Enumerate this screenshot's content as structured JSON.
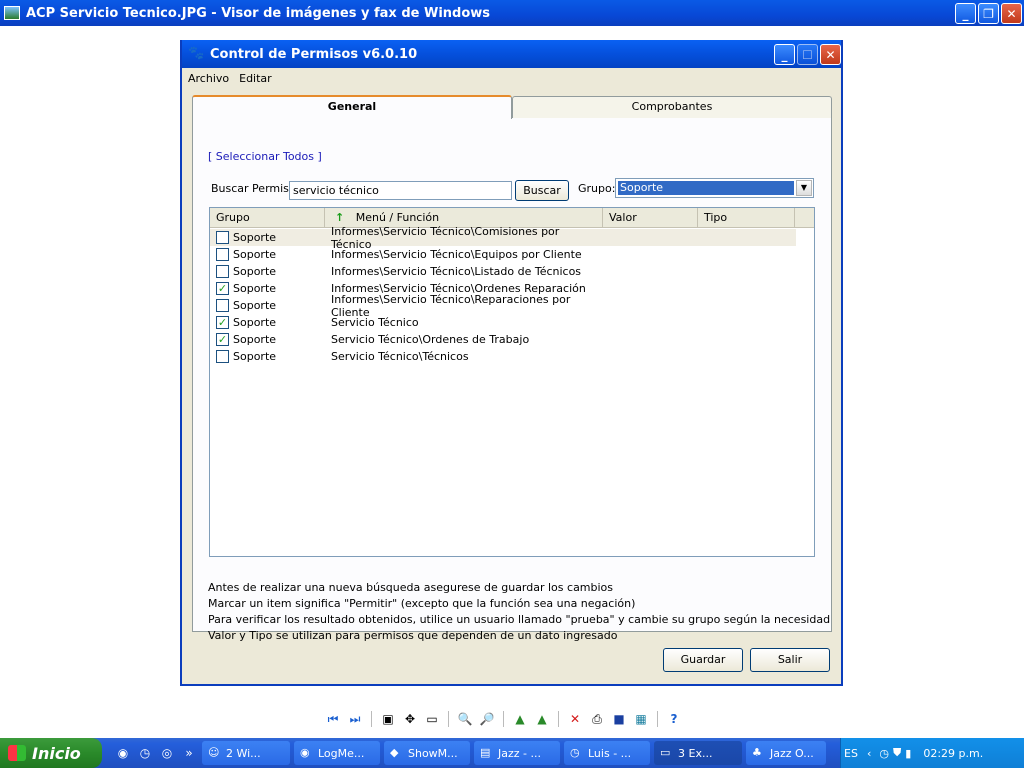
{
  "viewer": {
    "title": "ACP Servicio Tecnico.JPG - Visor de imágenes y fax de Windows"
  },
  "dialog": {
    "title": "Control de Permisos v6.0.10",
    "menu": [
      "Archivo",
      "Editar"
    ],
    "tabs": [
      {
        "label": "General",
        "active": true
      },
      {
        "label": "Comprobantes",
        "active": false
      }
    ],
    "select_all_link": "[ Seleccionar Todos ]",
    "search": {
      "label": "Buscar Permiso:",
      "value": "servicio técnico",
      "button": "Buscar"
    },
    "group": {
      "label": "Grupo:",
      "selected": "Soporte"
    },
    "grid": {
      "columns": [
        "Grupo",
        "Menú / Función",
        "Valor",
        "Tipo"
      ],
      "rows": [
        {
          "grupo": "Soporte",
          "menu": "Informes\\Servicio Técnico\\Comisiones por Técnico",
          "checked": false
        },
        {
          "grupo": "Soporte",
          "menu": "Informes\\Servicio Técnico\\Equipos por Cliente",
          "checked": false
        },
        {
          "grupo": "Soporte",
          "menu": "Informes\\Servicio Técnico\\Listado de Técnicos",
          "checked": false
        },
        {
          "grupo": "Soporte",
          "menu": "Informes\\Servicio Técnico\\Ordenes Reparación",
          "checked": true
        },
        {
          "grupo": "Soporte",
          "menu": "Informes\\Servicio Técnico\\Reparaciones por Cliente",
          "checked": false
        },
        {
          "grupo": "Soporte",
          "menu": "Servicio Técnico",
          "checked": true
        },
        {
          "grupo": "Soporte",
          "menu": "Servicio Técnico\\Ordenes de Trabajo",
          "checked": true
        },
        {
          "grupo": "Soporte",
          "menu": "Servicio Técnico\\Técnicos",
          "checked": false
        }
      ]
    },
    "notes": [
      "Antes de realizar una nueva búsqueda asegurese de guardar los cambios",
      "Marcar un item significa \"Permitir\" (excepto que la función sea una negación)",
      "Para verificar los resultado obtenidos, utilice un usuario llamado \"prueba\" y cambie su grupo según la necesidad",
      "Valor y Tipo se utilizan para permisos que dependen de un dato ingresado"
    ],
    "buttons": {
      "save": "Guardar",
      "exit": "Salir"
    }
  },
  "taskbar": {
    "start": "Inicio",
    "tasks": [
      {
        "label": "2 Wi...",
        "icon": "people-icon"
      },
      {
        "label": "LogMe...",
        "icon": "firefox-icon"
      },
      {
        "label": "ShowM...",
        "icon": "showmypc-icon"
      },
      {
        "label": "Jazz - ...",
        "icon": "document-icon"
      },
      {
        "label": "Luis - ...",
        "icon": "clock-icon"
      },
      {
        "label": "3 Ex...",
        "icon": "folder-icon"
      },
      {
        "label": "Jazz O...",
        "icon": "tree-icon"
      }
    ],
    "language": "ES",
    "clock": "02:29 p.m."
  }
}
